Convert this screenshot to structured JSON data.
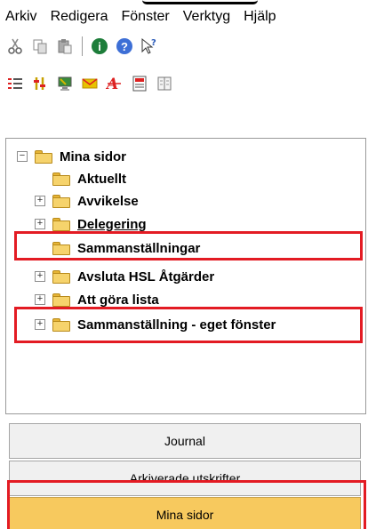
{
  "menubar": {
    "items": [
      "Arkiv",
      "Redigera",
      "Fönster",
      "Verktyg",
      "Hjälp"
    ]
  },
  "toolbar1": {
    "icons": [
      "cut-icon",
      "copy-icon",
      "paste-icon",
      "info-icon",
      "help-icon",
      "whats-this-icon"
    ]
  },
  "toolbar2": {
    "icons": [
      "list-icon",
      "tools-icon",
      "monitor-icon",
      "mail-icon",
      "font-icon",
      "report-icon",
      "book-icon"
    ]
  },
  "tree": {
    "root": "Mina sidor",
    "items": [
      {
        "label": "Aktuellt"
      },
      {
        "label": "Avvikelse"
      },
      {
        "label": "Delegering"
      },
      {
        "label": "Sammanställningar"
      },
      {
        "label": "Avsluta HSL Åtgärder"
      },
      {
        "label": "Att göra lista"
      },
      {
        "label": "Sammanställning - eget fönster"
      }
    ]
  },
  "nav": {
    "journal": "Journal",
    "archived": "Arkiverade utskrifter",
    "my_pages": "Mina sidor"
  },
  "colors": {
    "highlight": "#e31b23",
    "active_nav": "#f7c95e"
  }
}
